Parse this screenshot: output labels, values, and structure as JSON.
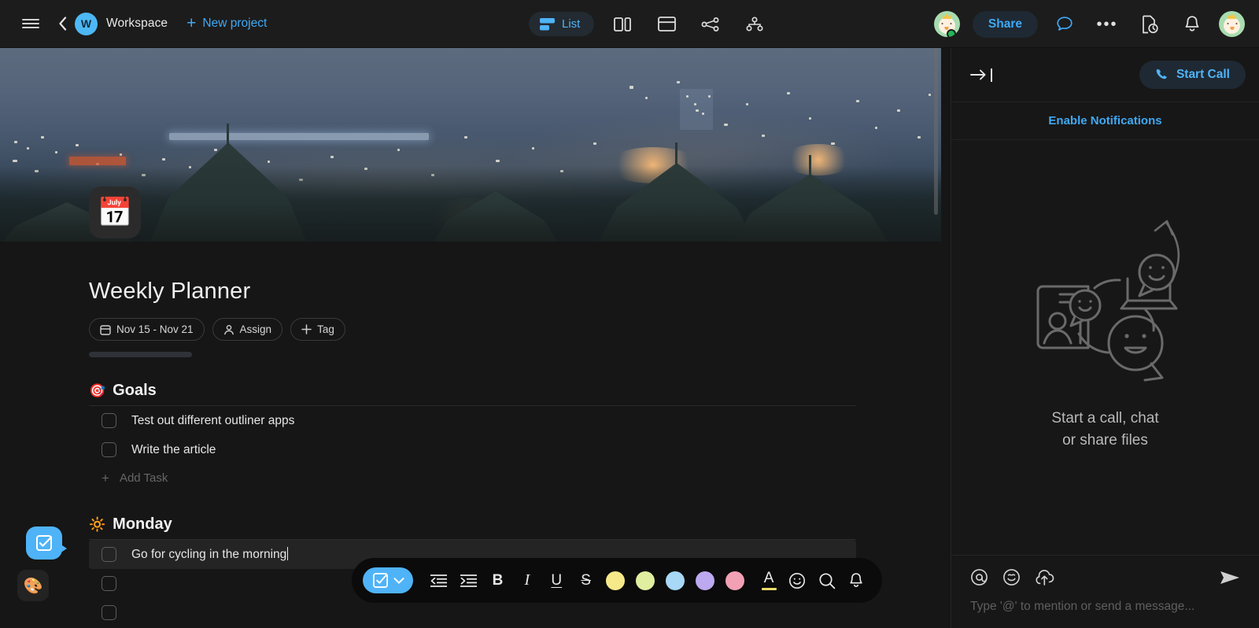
{
  "topbar": {
    "menu_icon": "hamburger-menu-icon",
    "back_icon": "chevron-left-icon",
    "workspace_initial": "W",
    "workspace_name": "Workspace",
    "new_project_label": "New project",
    "views": {
      "list_label": "List",
      "list_icon": "list-view-icon",
      "board_icon": "board-view-icon",
      "card_icon": "card-view-icon",
      "graph_icon": "share-graph-icon",
      "org_icon": "org-tree-icon"
    },
    "share_label": "Share",
    "chat_icon": "chat-bubble-icon",
    "more_icon": "more-horizontal-icon",
    "history_icon": "document-history-icon",
    "bell_icon": "bell-icon",
    "avatar_icon": "user-avatar",
    "accent_blue": "#3fa9f5"
  },
  "document": {
    "emoji": "📅",
    "emoji_name": "calendar-emoji",
    "title": "Weekly Planner",
    "chips": [
      {
        "label": "Nov 15 - Nov 21",
        "icon": "calendar-icon"
      },
      {
        "label": "Assign",
        "icon": "person-icon"
      },
      {
        "label": "Tag",
        "icon": "plus-icon"
      }
    ],
    "sections": [
      {
        "emoji": "🎯",
        "emoji_name": "dart-target-emoji",
        "title": "Goals",
        "tasks": [
          {
            "text": "Test out different outliner apps",
            "checked": false
          },
          {
            "text": "Write the article",
            "checked": false
          }
        ],
        "add_task_label": "Add Task"
      },
      {
        "emoji": "🔆",
        "emoji_name": "sun-emoji",
        "title": "Monday",
        "tasks": [
          {
            "text": "Go for cycling in the morning",
            "checked": false,
            "active": true
          },
          {
            "text": "",
            "checked": false
          },
          {
            "text": "",
            "checked": false
          }
        ]
      }
    ]
  },
  "format_toolbar": {
    "primary_icon": "checkbox-task-icon",
    "primary_caret_icon": "chevron-down-icon",
    "outdent_icon": "outdent-icon",
    "indent_icon": "indent-icon",
    "bold": "B",
    "italic": "I",
    "underline": "U",
    "strikethrough": "S",
    "colors": [
      "#f6e98a",
      "#e0eea0",
      "#a7d8f5",
      "#bda9ef",
      "#f2a0b4"
    ],
    "text_color_letter": "A",
    "text_color_underline": "#e8dc6a",
    "emoji_icon": "smiley-icon",
    "search_icon": "search-icon",
    "bell_icon": "bell-icon"
  },
  "floating_buttons": {
    "task_icon": "checkbox-task-icon",
    "palette_emoji": "🎨",
    "palette_icon": "palette-icon"
  },
  "right_panel": {
    "collapse_icon": "collapse-panel-right-icon",
    "start_call_label": "Start Call",
    "phone_icon": "phone-icon",
    "enable_notifications_label": "Enable Notifications",
    "empty_state": {
      "illustration": "call-chat-files-illustration",
      "line1": "Start a call, chat",
      "line2": "or share files"
    },
    "composer": {
      "mention_icon": "at-mention-icon",
      "emoji_icon": "smiley-icon",
      "upload_icon": "cloud-upload-icon",
      "send_icon": "send-icon",
      "placeholder": "Type '@' to mention or send a message..."
    }
  }
}
